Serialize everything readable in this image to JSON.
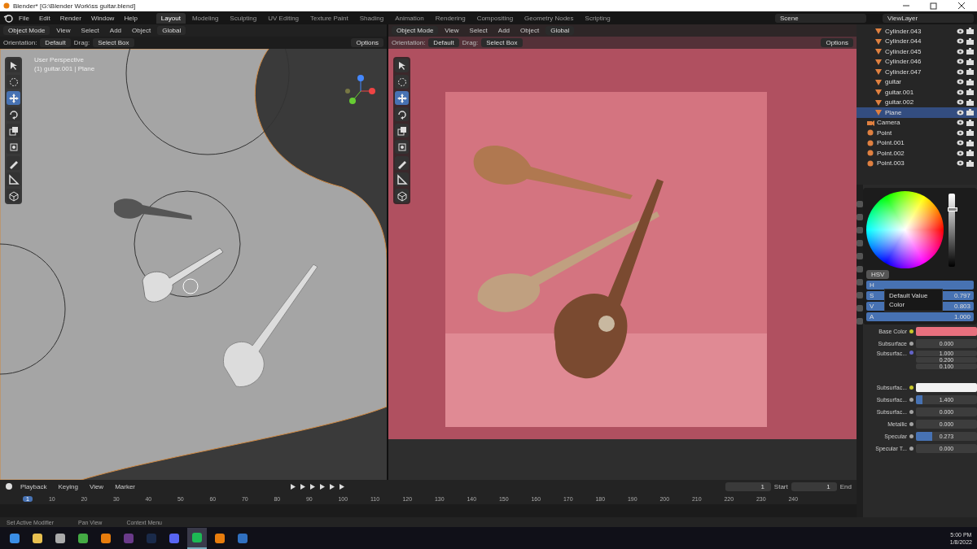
{
  "window": {
    "title": "Blender* [G:\\Blender Work\\ss guitar.blend]"
  },
  "menu": [
    "File",
    "Edit",
    "Render",
    "Window",
    "Help"
  ],
  "workspaces": [
    {
      "label": "Layout",
      "selected": true
    },
    {
      "label": "Modeling",
      "selected": false
    },
    {
      "label": "Sculpting",
      "selected": false
    },
    {
      "label": "UV Editing",
      "selected": false
    },
    {
      "label": "Texture Paint",
      "selected": false
    },
    {
      "label": "Shading",
      "selected": false
    },
    {
      "label": "Animation",
      "selected": false
    },
    {
      "label": "Rendering",
      "selected": false
    },
    {
      "label": "Compositing",
      "selected": false
    },
    {
      "label": "Geometry Nodes",
      "selected": false
    },
    {
      "label": "Scripting",
      "selected": false
    }
  ],
  "scene": "Scene",
  "view_layer": "ViewLayer",
  "viewports": [
    {
      "kind": "solid",
      "mode": "Object Mode",
      "menus": [
        "View",
        "Select",
        "Add",
        "Object"
      ],
      "transform": "Global",
      "orientation_label": "Orientation:",
      "orientation": "Default",
      "drag_label": "Drag:",
      "drag": "Select Box",
      "options": "Options",
      "overlay": [
        "User Perspective",
        "(1) guitar.001 | Plane"
      ],
      "tools": [
        {
          "selected": false
        },
        {
          "selected": false
        },
        {
          "selected": true
        },
        {
          "selected": false
        },
        {
          "selected": false
        },
        {
          "selected": false
        },
        {
          "selected": false
        },
        {
          "selected": false
        },
        {
          "selected": false
        }
      ]
    },
    {
      "kind": "rendered",
      "mode": "Object Mode",
      "menus": [
        "View",
        "Select",
        "Add",
        "Object"
      ],
      "transform": "Global",
      "orientation_label": "Orientation:",
      "orientation": "Default",
      "drag_label": "Drag:",
      "drag": "Select Box",
      "options": "Options",
      "tools": [
        {
          "selected": false
        },
        {
          "selected": false
        },
        {
          "selected": true
        },
        {
          "selected": false
        },
        {
          "selected": false
        },
        {
          "selected": false
        },
        {
          "selected": false
        },
        {
          "selected": false
        },
        {
          "selected": false
        }
      ]
    }
  ],
  "outliner": {
    "items": [
      {
        "children": [
          {
            "label": "Cylinder.043",
            "kind": "mesh",
            "selected": false
          },
          {
            "label": "Cylinder.044",
            "kind": "mesh",
            "selected": false
          },
          {
            "label": "Cylinder.045",
            "kind": "mesh",
            "selected": false
          },
          {
            "label": "Cylinder.046",
            "kind": "mesh",
            "selected": false
          },
          {
            "label": "Cylinder.047",
            "kind": "mesh",
            "selected": false
          },
          {
            "label": "guitar",
            "kind": "mesh",
            "selected": false
          },
          {
            "label": "guitar.001",
            "kind": "mesh",
            "selected": false
          },
          {
            "label": "guitar.002",
            "kind": "mesh",
            "selected": false
          },
          {
            "label": "Plane",
            "kind": "mesh",
            "selected": true
          }
        ]
      },
      {
        "label": "Camera",
        "kind": "camera",
        "selected": false
      },
      {
        "label": "Point",
        "kind": "light",
        "selected": false
      },
      {
        "label": "Point.001",
        "kind": "light",
        "selected": false
      },
      {
        "label": "Point.002",
        "kind": "light",
        "selected": false
      },
      {
        "label": "Point.003",
        "kind": "light",
        "selected": false
      }
    ]
  },
  "color_picker": {
    "mode": "HSV",
    "tooltip": [
      "Default Value",
      "Color"
    ],
    "brightness": {
      "level": 0.8
    },
    "channels": [
      {
        "label": "H"
      },
      {
        "label": "S",
        "value": "0.797"
      },
      {
        "label": "V",
        "value": "0.803"
      },
      {
        "label": "A",
        "value": "1.000"
      }
    ]
  },
  "properties": [
    {
      "kind": "color",
      "label": "Base Color",
      "color": "#e8707e"
    },
    {
      "kind": "number",
      "label": "Subsurface",
      "value": "0.000"
    },
    {
      "kind": "vector",
      "label": "Subsurfac...",
      "values": [
        "1.000",
        "0.200",
        "0.100"
      ]
    },
    {
      "kind": "color",
      "label": "Subsurfac...",
      "color": "#f2f2f2"
    },
    {
      "kind": "number",
      "label": "Subsurfac...",
      "value": "1.400",
      "level": 0.1
    },
    {
      "kind": "number",
      "label": "Subsurfac...",
      "value": "0.000"
    },
    {
      "kind": "number",
      "label": "Metallic",
      "value": "0.000"
    },
    {
      "kind": "number",
      "label": "Specular",
      "value": "0.273",
      "level": 0.27
    },
    {
      "kind": "number",
      "label": "Specular T...",
      "value": "0.000"
    }
  ],
  "timeline": {
    "menus": [
      "Playback",
      "Keying",
      "View",
      "Marker"
    ],
    "frame": "1",
    "start_label": "Start",
    "start": "1",
    "end_label": "End",
    "ticks": [
      "1",
      "10",
      "20",
      "30",
      "40",
      "50",
      "60",
      "70",
      "80",
      "90",
      "100",
      "110",
      "120",
      "130",
      "140",
      "150",
      "160",
      "170",
      "180",
      "190",
      "200",
      "210",
      "220",
      "230",
      "240"
    ]
  },
  "status_bar": [
    "Set Active Modifier",
    "Pan View",
    "Context Menu"
  ],
  "taskbar": {
    "apps": [
      {
        "selected": false
      },
      {
        "selected": false
      },
      {
        "selected": false
      },
      {
        "selected": false
      },
      {
        "selected": false
      },
      {
        "selected": false
      },
      {
        "selected": false
      },
      {
        "selected": false
      },
      {
        "selected": true
      },
      {
        "selected": false
      },
      {
        "selected": false
      }
    ],
    "time": "5:00 PM",
    "date": "1/8/2022"
  }
}
